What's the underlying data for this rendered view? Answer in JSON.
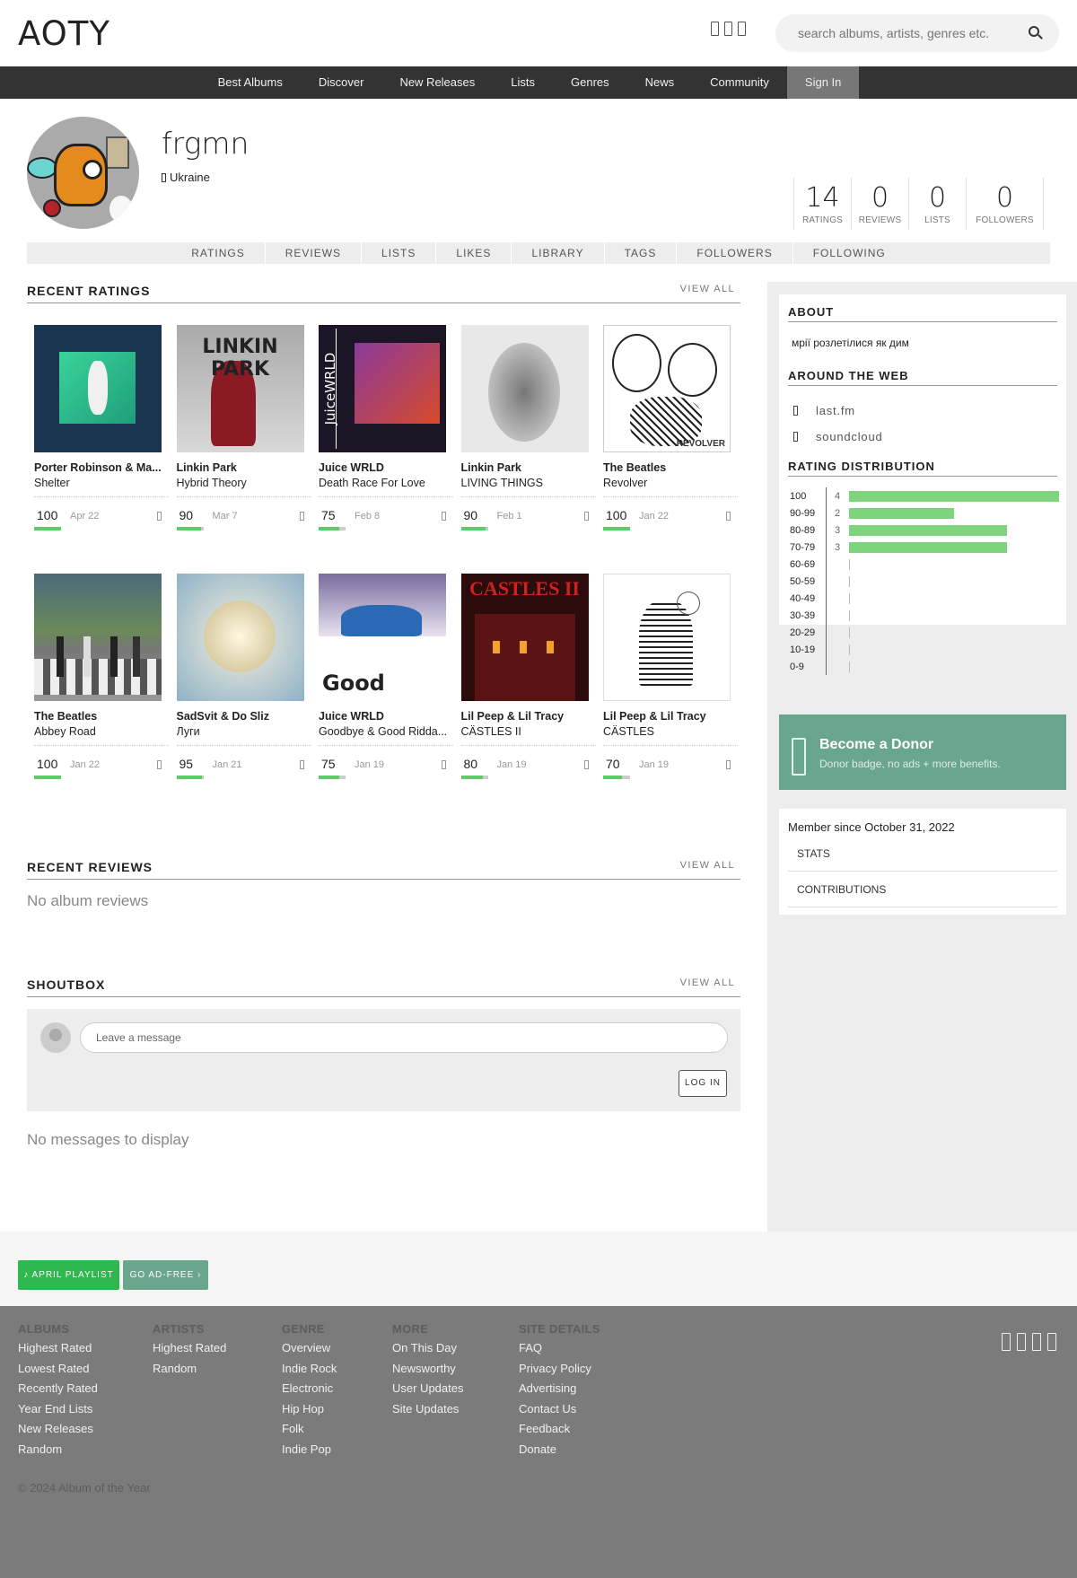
{
  "header": {
    "logo": "AOTY",
    "search_placeholder": "search albums, artists, genres etc."
  },
  "nav": [
    "Best Albums",
    "Discover",
    "New Releases",
    "Lists",
    "Genres",
    "News",
    "Community"
  ],
  "nav_signin": "Sign In",
  "profile": {
    "name": "frgmn",
    "location": "Ukraine",
    "stats": [
      {
        "num": "14",
        "label": "RATINGS"
      },
      {
        "num": "0",
        "label": "REVIEWS"
      },
      {
        "num": "0",
        "label": "LISTS"
      },
      {
        "num": "0",
        "label": "FOLLOWERS"
      }
    ],
    "tabs": [
      "RATINGS",
      "REVIEWS",
      "LISTS",
      "LIKES",
      "LIBRARY",
      "TAGS",
      "FOLLOWERS",
      "FOLLOWING"
    ]
  },
  "recent_ratings": {
    "title": "RECENT RATINGS",
    "view_all": "VIEW ALL",
    "albums": [
      {
        "artist": "Porter Robinson & Ma...",
        "title": "Shelter",
        "score": "100",
        "score_pct": 100,
        "date": "Apr 22"
      },
      {
        "artist": "Linkin Park",
        "title": "Hybrid Theory",
        "score": "90",
        "score_pct": 90,
        "date": "Mar 7"
      },
      {
        "artist": "Juice WRLD",
        "title": "Death Race For Love",
        "score": "75",
        "score_pct": 75,
        "date": "Feb 8"
      },
      {
        "artist": "Linkin Park",
        "title": "LIVING THINGS",
        "score": "90",
        "score_pct": 90,
        "date": "Feb 1"
      },
      {
        "artist": "The Beatles",
        "title": "Revolver",
        "score": "100",
        "score_pct": 100,
        "date": "Jan 22"
      },
      {
        "artist": "The Beatles",
        "title": "Abbey Road",
        "score": "100",
        "score_pct": 100,
        "date": "Jan 22"
      },
      {
        "artist": "SadSvit & Do Sliz",
        "title": "Луги",
        "score": "95",
        "score_pct": 95,
        "date": "Jan 21"
      },
      {
        "artist": "Juice WRLD",
        "title": "Goodbye & Good Ridda...",
        "score": "75",
        "score_pct": 75,
        "date": "Jan 19"
      },
      {
        "artist": "Lil Peep & Lil Tracy",
        "title": "CÄSTLES II",
        "score": "80",
        "score_pct": 80,
        "date": "Jan 19"
      },
      {
        "artist": "Lil Peep & Lil Tracy",
        "title": "CÄSTLES",
        "score": "70",
        "score_pct": 70,
        "date": "Jan 19"
      }
    ]
  },
  "cover_text": {
    "linkin": "LINKIN PARK",
    "juice": "JuiceWRLD",
    "revolver": "REVOLVER",
    "goodbye": "Good",
    "castles2": "CASTLES II"
  },
  "recent_reviews": {
    "title": "RECENT REVIEWS",
    "view_all": "VIEW ALL",
    "empty": "No album reviews"
  },
  "shoutbox": {
    "title": "SHOUTBOX",
    "view_all": "VIEW ALL",
    "placeholder": "Leave a message",
    "login": "LOG IN",
    "empty": "No messages to display"
  },
  "sidebar": {
    "about_title": "ABOUT",
    "about_text": "мрії розлетілися як дим",
    "web_title": "AROUND THE WEB",
    "web_links": [
      "last.fm",
      "soundcloud"
    ],
    "dist_title": "RATING DISTRIBUTION",
    "distribution": [
      {
        "label": "100",
        "count": "4",
        "value": 4
      },
      {
        "label": "90-99",
        "count": "2",
        "value": 2
      },
      {
        "label": "80-89",
        "count": "3",
        "value": 3
      },
      {
        "label": "70-79",
        "count": "3",
        "value": 3
      },
      {
        "label": "60-69",
        "count": "",
        "value": 0
      },
      {
        "label": "50-59",
        "count": "",
        "value": 0
      },
      {
        "label": "40-49",
        "count": "",
        "value": 0
      },
      {
        "label": "30-39",
        "count": "",
        "value": 0
      },
      {
        "label": "20-29",
        "count": "",
        "value": 0
      },
      {
        "label": "10-19",
        "count": "",
        "value": 0
      },
      {
        "label": "0-9",
        "count": "",
        "value": 0
      }
    ],
    "donor_title": "Become a Donor",
    "donor_sub": "Donor badge, no ads + more benefits.",
    "member_since": "Member since October 31, 2022",
    "member_links": [
      "STATS",
      "CONTRIBUTIONS"
    ]
  },
  "strip": {
    "playlist": "APRIL PLAYLIST",
    "adfree": "GO AD-FREE"
  },
  "footer": {
    "columns": [
      {
        "head": "ALBUMS",
        "items": [
          "Highest Rated",
          "Lowest Rated",
          "Recently Rated",
          "Year End Lists",
          "New Releases",
          "Random"
        ]
      },
      {
        "head": "ARTISTS",
        "items": [
          "Highest Rated",
          "Random"
        ]
      },
      {
        "head": "GENRE",
        "items": [
          "Overview",
          "Indie Rock",
          "Electronic",
          "Hip Hop",
          "Folk",
          "Indie Pop"
        ]
      },
      {
        "head": "MORE",
        "items": [
          "On This Day",
          "Newsworthy",
          "User Updates",
          "Site Updates"
        ]
      },
      {
        "head": "SITE DETAILS",
        "items": [
          "FAQ",
          "Privacy Policy",
          "Advertising",
          "Contact Us",
          "Feedback",
          "Donate"
        ]
      }
    ],
    "copyright": "© 2024 Album of the Year"
  },
  "colors": {
    "score_bar": "#5ecb65",
    "dist_bar": "#7ed47c",
    "donor": "#6aa58e",
    "playlist_btn": "#2fb84f",
    "nav_bg": "#333333",
    "footer_bg": "#7b7b7b"
  }
}
